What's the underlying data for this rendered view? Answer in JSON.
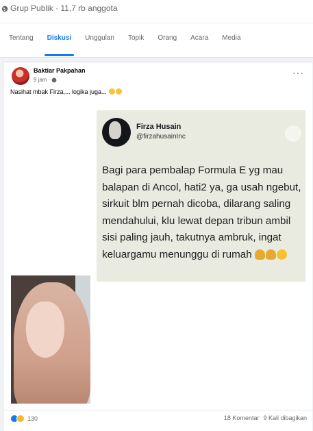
{
  "group": {
    "meta": "Grup Publik · 11,7 rb anggota"
  },
  "tabs": [
    {
      "label": "Tentang",
      "active": false
    },
    {
      "label": "Diskusi",
      "active": true
    },
    {
      "label": "Unggulan",
      "active": false
    },
    {
      "label": "Topik",
      "active": false
    },
    {
      "label": "Orang",
      "active": false
    },
    {
      "label": "Acara",
      "active": false
    },
    {
      "label": "Media",
      "active": false
    }
  ],
  "post": {
    "author": "Baktiar Pakpahan",
    "time": "9 jam ·",
    "caption": "Nasihat mbak Firza,... logika juga...",
    "more": "···",
    "tweet": {
      "name": "Firza Husain",
      "handle": "@firzahusainInc",
      "body": "Bagi para pembalap Formula E yg mau balapan di Ancol, hati2 ya, ga usah ngebut, sirkuit blm pernah dicoba, dilarang saling mendahului, klu lewat depan tribun ambil sisi paling jauh, takutnya ambruk, ingat keluargamu menunggu di rumah"
    },
    "footer": {
      "reactions_count": "130",
      "comments": "18 Komentar",
      "shares": "9 Kali dibagikan"
    }
  },
  "colors": {
    "accent": "#1877f2",
    "page_bg": "#f0f2f5",
    "tweet_bg": "#e9ebe0"
  },
  "icons": [
    "globe-icon",
    "privacy-icon",
    "more-icon",
    "like-icon",
    "haha-icon"
  ]
}
